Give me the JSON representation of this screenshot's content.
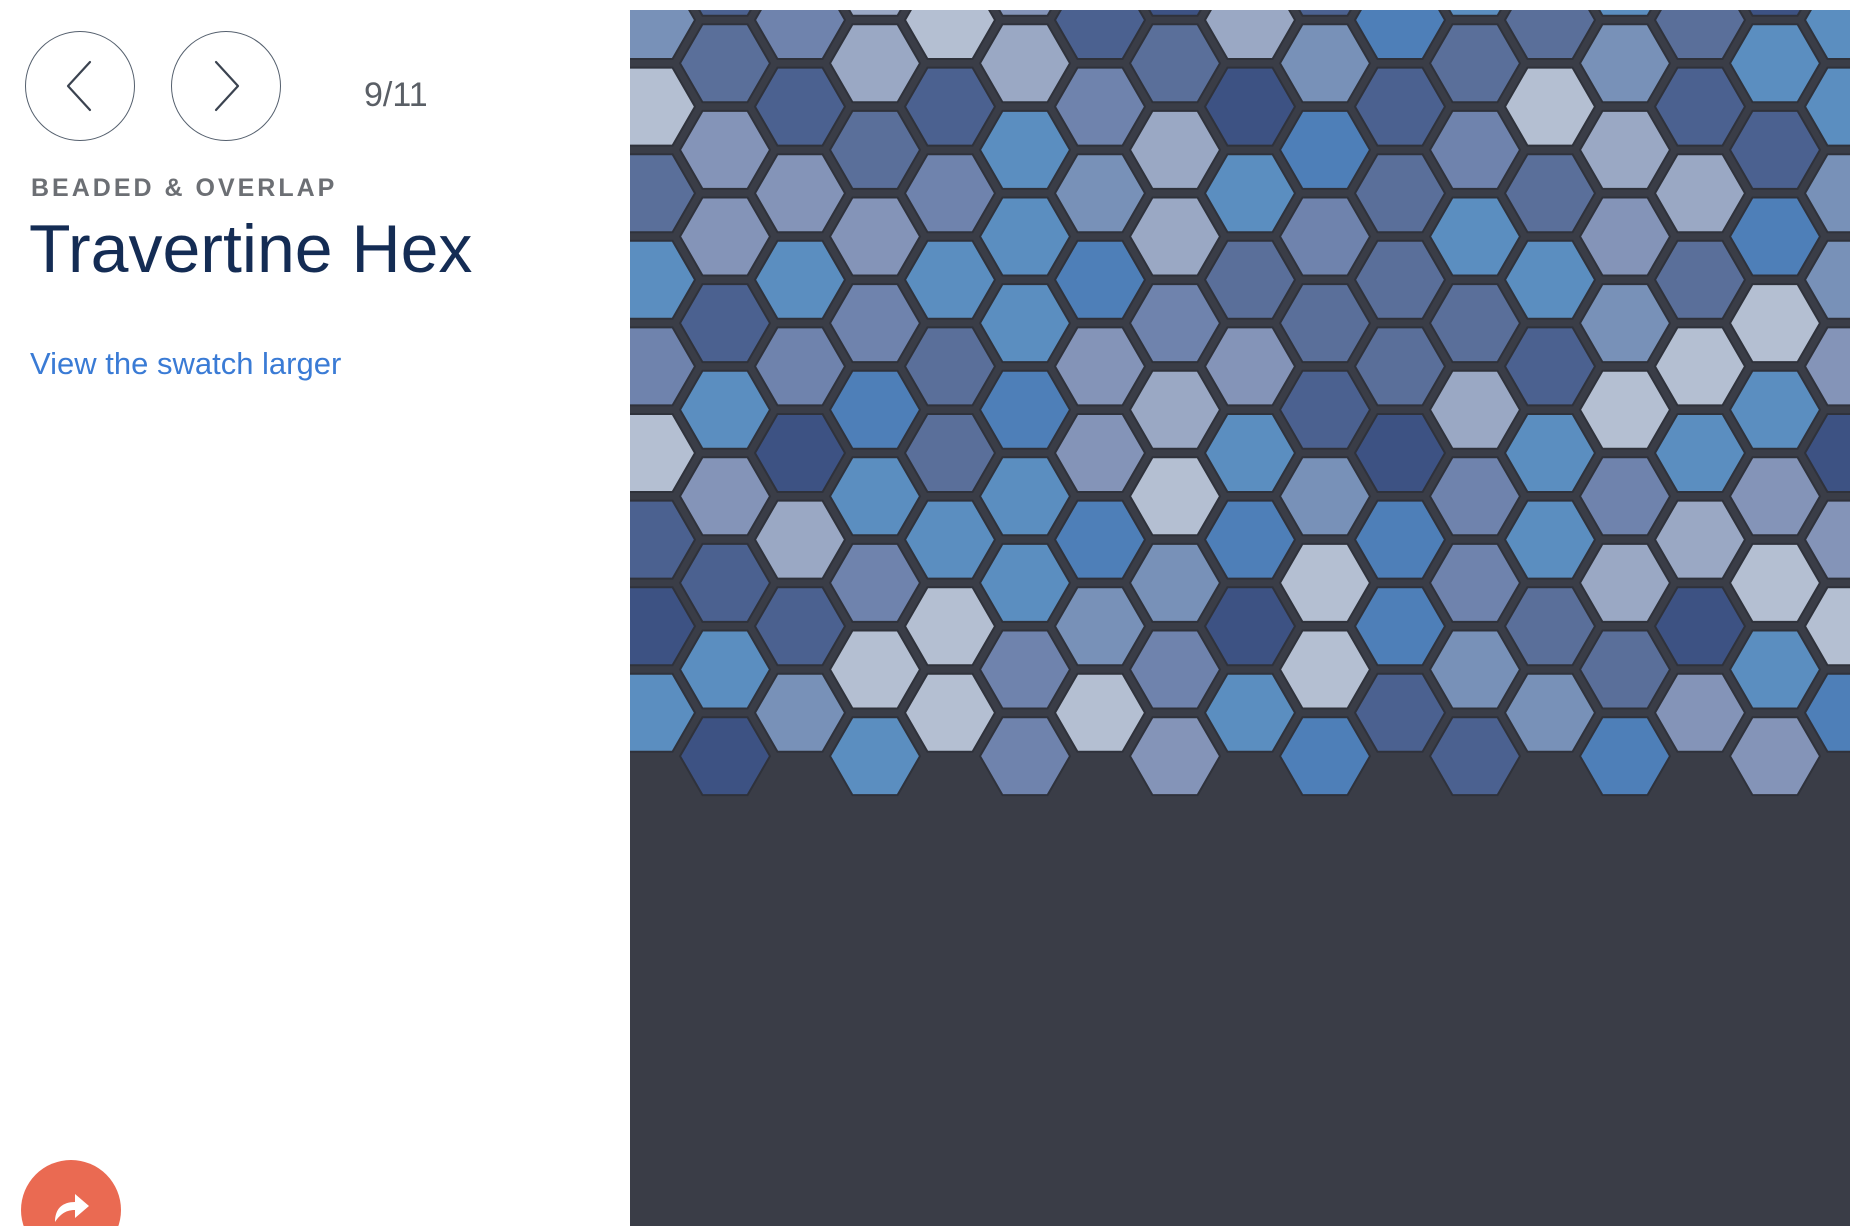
{
  "navigation": {
    "prev_icon": "chevron-left-icon",
    "next_icon": "chevron-right-icon",
    "counter": "9/11"
  },
  "product": {
    "category": "BEADED & OVERLAP",
    "title": "Travertine Hex",
    "swatch_link": "View the swatch larger"
  },
  "share": {
    "icon": "share-arrow-icon",
    "color": "#ea6a52"
  },
  "swatch": {
    "pattern": "hexagon tile mosaic",
    "grout_color": "#3a3d47",
    "tile_colors": [
      "#5a6f9a",
      "#4b6190",
      "#6f83ad",
      "#9aa8c4",
      "#5b8ec0",
      "#3d5283",
      "#b4bfd2",
      "#7891b8",
      "#4e7fb8",
      "#8494b8"
    ]
  },
  "colors": {
    "title": "#142c54",
    "link": "#3a7bd5",
    "category": "#6c6f74",
    "counter": "#5a5f66"
  }
}
